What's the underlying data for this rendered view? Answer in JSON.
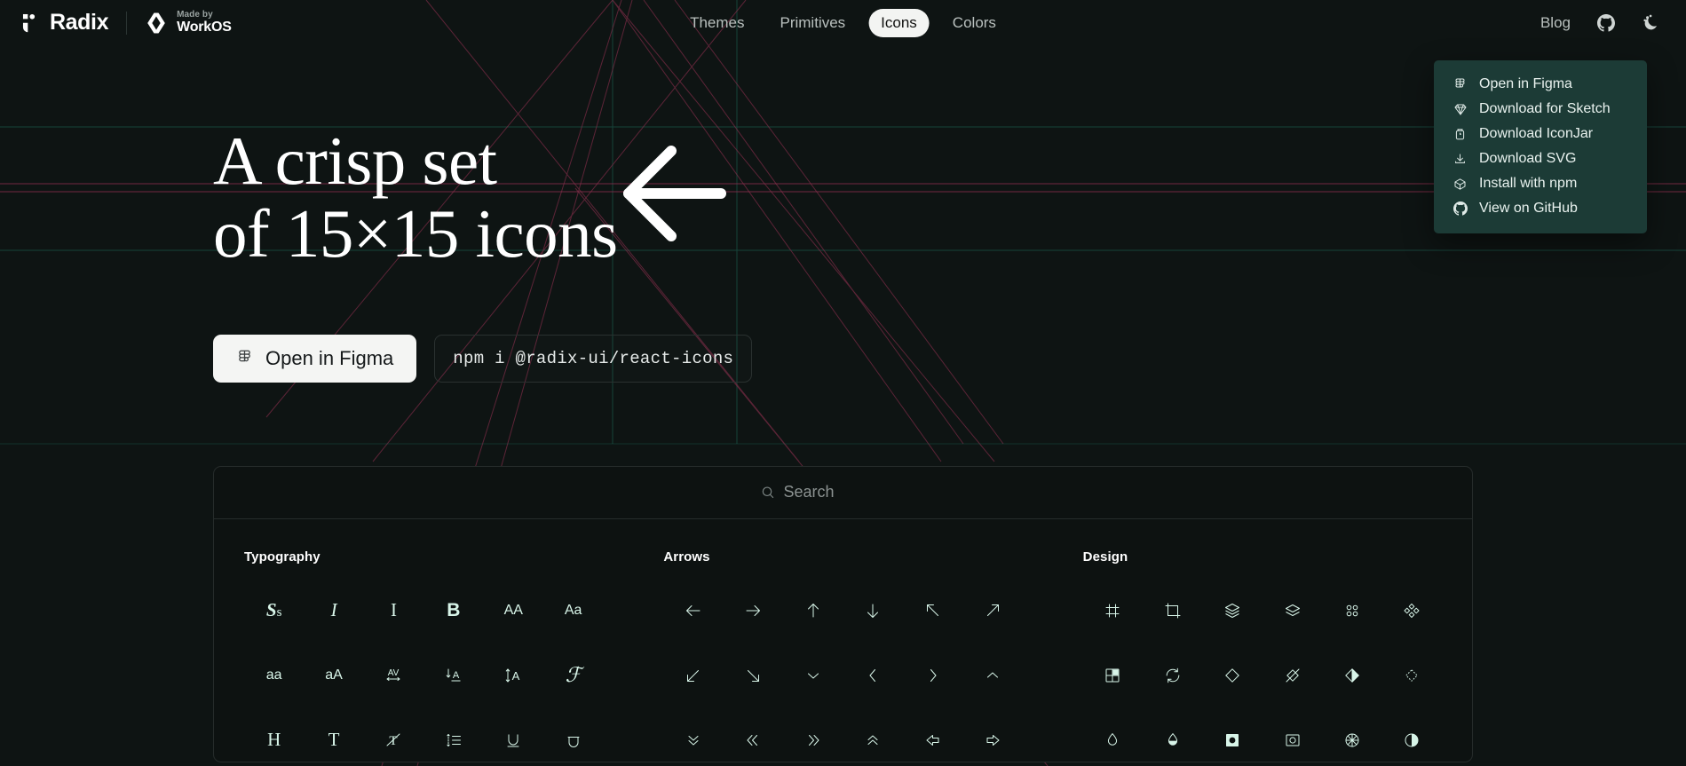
{
  "header": {
    "brand": {
      "logo_icon": "radix-logo-icon",
      "name": "Radix",
      "workos_icon": "workos-logo-icon",
      "made_by": "Made by",
      "workos_name": "WorkOS"
    },
    "nav": [
      {
        "label": "Themes",
        "active": false
      },
      {
        "label": "Primitives",
        "active": false
      },
      {
        "label": "Icons",
        "active": true
      },
      {
        "label": "Colors",
        "active": false
      }
    ],
    "right": {
      "blog_label": "Blog",
      "github_icon": "github-icon",
      "theme_toggle_icon": "moon-icon"
    }
  },
  "dropdown": {
    "items": [
      {
        "label": "Open in Figma",
        "icon": "figma-icon"
      },
      {
        "label": "Download for Sketch",
        "icon": "sketch-icon"
      },
      {
        "label": "Download IconJar",
        "icon": "iconjar-icon"
      },
      {
        "label": "Download SVG",
        "icon": "download-icon"
      },
      {
        "label": "Install with npm",
        "icon": "box-icon"
      },
      {
        "label": "View on GitHub",
        "icon": "github-icon"
      }
    ],
    "background_color": "#1c3b36"
  },
  "hero": {
    "title": "A crisp set\nof 15×15 icons",
    "figma_button": "Open in Figma",
    "figma_button_icon": "figma-icon",
    "npm_command": "npm i @radix-ui/react-icons"
  },
  "explorer": {
    "search": {
      "placeholder": "Search",
      "value": "",
      "icon": "search-icon"
    },
    "sections": [
      {
        "title": "Typography",
        "icons": [
          "case-sensitive-icon",
          "font-italic-icon",
          "text-italic-icon",
          "font-bold-icon",
          "letter-case-uppercase-icon",
          "letter-case-capitalize-icon",
          "letter-case-lowercase-icon",
          "letter-case-toggle-icon",
          "letter-spacing-icon",
          "align-baseline-icon",
          "line-height-icon",
          "font-family-icon",
          "heading-icon",
          "text-icon",
          "strikethrough-icon",
          "line-height-list-icon",
          "underline-icon",
          "overline-icon"
        ]
      },
      {
        "title": "Arrows",
        "icons": [
          "arrow-left-icon",
          "arrow-right-icon",
          "arrow-up-icon",
          "arrow-down-icon",
          "arrow-top-left-icon",
          "arrow-top-right-icon",
          "arrow-bottom-left-icon",
          "arrow-bottom-right-icon",
          "chevron-down-icon",
          "chevron-left-icon",
          "chevron-right-icon",
          "chevron-up-icon",
          "double-arrow-down-icon",
          "double-arrow-left-icon",
          "double-arrow-right-icon",
          "double-arrow-up-icon",
          "thick-arrow-left-icon",
          "thick-arrow-right-icon"
        ]
      },
      {
        "title": "Design",
        "icons": [
          "frame-icon",
          "crop-icon",
          "layers-icon",
          "stack-icon",
          "group-icon",
          "component-1-icon",
          "dashboard-icon",
          "rotate-counter-clockwise-icon",
          "component-instance-icon",
          "component-none-icon",
          "component-boolean-icon",
          "component-placeholder-icon",
          "opacity-icon",
          "blending-mode-icon",
          "mask-on-icon",
          "mask-off-icon",
          "color-wheel-icon",
          "shadow-icon"
        ]
      }
    ]
  },
  "colors": {
    "page_background": "#0e1413",
    "icon_tint": "#d8f5e9",
    "guide_teal": "#1f6b5a",
    "guide_pink": "#8c2f4d",
    "accent_light": "#f3f4f2"
  }
}
